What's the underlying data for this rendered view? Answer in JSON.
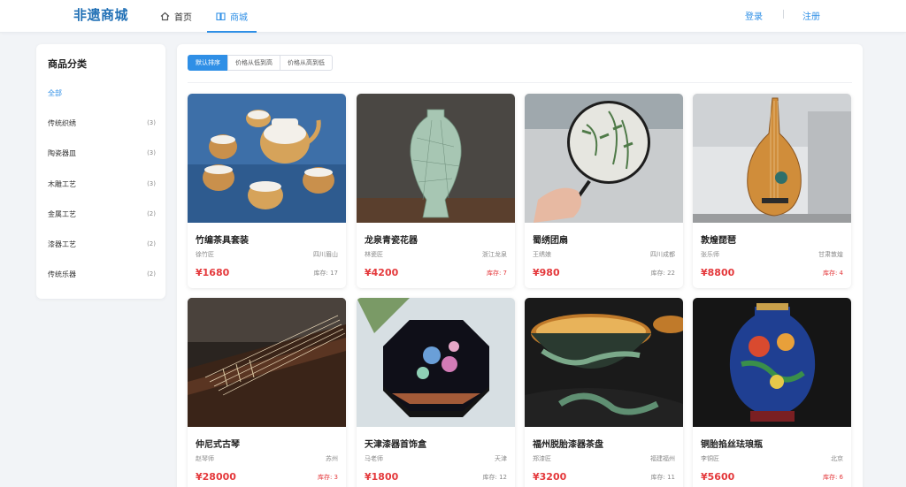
{
  "header": {
    "logo": "非遗商城",
    "nav": [
      {
        "label": "首页",
        "icon": "home-icon"
      },
      {
        "label": "商城",
        "icon": "book-icon"
      }
    ],
    "login": "登录",
    "register": "注册"
  },
  "sidebar": {
    "title": "商品分类",
    "items": [
      {
        "label": "全部",
        "count": ""
      },
      {
        "label": "传统织绣",
        "count": "(3)"
      },
      {
        "label": "陶瓷器皿",
        "count": "(3)"
      },
      {
        "label": "木雕工艺",
        "count": "(3)"
      },
      {
        "label": "金属工艺",
        "count": "(2)"
      },
      {
        "label": "漆器工艺",
        "count": "(2)"
      },
      {
        "label": "传统乐器",
        "count": "(2)"
      }
    ]
  },
  "sort": {
    "options": [
      "默认排序",
      "价格从低到高",
      "价格从高到低"
    ],
    "active": "默认排序"
  },
  "products": [
    {
      "name": "竹编茶具套装",
      "maker": "徐竹匠",
      "origin": "四川眉山",
      "price": "¥1680",
      "stock": "库存: 17",
      "low": false
    },
    {
      "name": "龙泉青瓷花器",
      "maker": "林瓷匠",
      "origin": "浙江龙泉",
      "price": "¥4200",
      "stock": "库存: 7",
      "low": true
    },
    {
      "name": "蜀绣团扇",
      "maker": "王绣娘",
      "origin": "四川成都",
      "price": "¥980",
      "stock": "库存: 22",
      "low": false
    },
    {
      "name": "敦煌琵琶",
      "maker": "张乐师",
      "origin": "甘肃敦煌",
      "price": "¥8800",
      "stock": "库存: 4",
      "low": true
    },
    {
      "name": "仲尼式古琴",
      "maker": "赵琴师",
      "origin": "苏州",
      "price": "¥28000",
      "stock": "库存: 3",
      "low": true
    },
    {
      "name": "天津漆器首饰盒",
      "maker": "马老师",
      "origin": "天津",
      "price": "¥1800",
      "stock": "库存: 12",
      "low": false
    },
    {
      "name": "福州脱胎漆器茶盘",
      "maker": "郑漆匠",
      "origin": "福建福州",
      "price": "¥3200",
      "stock": "库存: 11",
      "low": false
    },
    {
      "name": "铜胎掐丝珐琅瓶",
      "maker": "李铜匠",
      "origin": "北京",
      "price": "¥5600",
      "stock": "库存: 6",
      "low": true
    }
  ],
  "colors": {
    "accent": "#2f8fe6",
    "price": "#e4393c",
    "logo": "#1f6fb5"
  }
}
